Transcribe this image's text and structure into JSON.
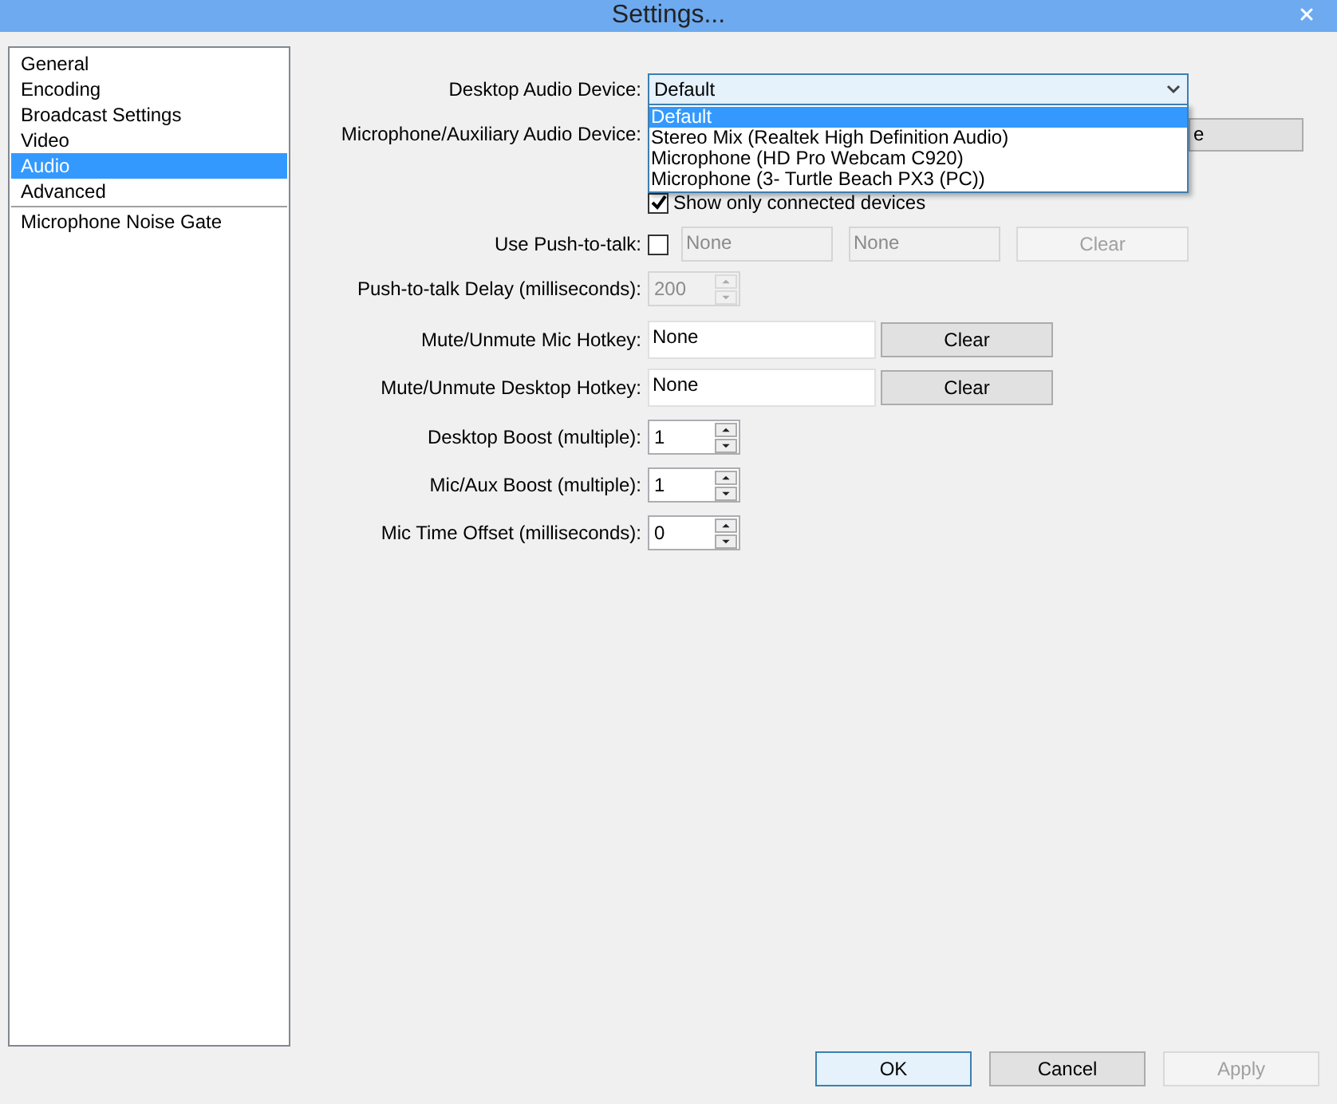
{
  "window": {
    "title": "Settings..."
  },
  "sidebar": {
    "items": [
      {
        "label": "General",
        "selected": false
      },
      {
        "label": "Encoding",
        "selected": false
      },
      {
        "label": "Broadcast Settings",
        "selected": false
      },
      {
        "label": "Video",
        "selected": false
      },
      {
        "label": "Audio",
        "selected": true
      },
      {
        "label": "Advanced",
        "selected": false
      }
    ],
    "plugin_items": [
      {
        "label": "Microphone Noise Gate",
        "selected": false
      }
    ]
  },
  "audio": {
    "desktop_device": {
      "label": "Desktop Audio Device:",
      "value": "Default",
      "expanded": true,
      "options": [
        {
          "label": "Default",
          "selected": true
        },
        {
          "label": "Stereo Mix (Realtek High Definition Audio)",
          "selected": false
        },
        {
          "label": "Microphone (HD Pro Webcam C920)",
          "selected": false
        },
        {
          "label": "Microphone (3- Turtle Beach PX3 (PC))",
          "selected": false
        }
      ]
    },
    "mic_device": {
      "label": "Microphone/Auxiliary Audio Device:",
      "button": "e"
    },
    "show_connected": {
      "label": "Show only connected devices",
      "checked": true
    },
    "push_to_talk": {
      "label": "Use Push-to-talk:",
      "checked": false,
      "hotkey": "None",
      "hotkey_alt": "None",
      "clear": {
        "label": "Clear",
        "disabled": true
      }
    },
    "ptt_delay": {
      "label": "Push-to-talk Delay (milliseconds):",
      "value": "200",
      "disabled": true
    },
    "hotkeys": [
      {
        "label": "Mute/Unmute Mic Hotkey:",
        "value": "None",
        "clear": "Clear"
      },
      {
        "label": "Mute/Unmute Desktop Hotkey:",
        "value": "None",
        "clear": "Clear"
      }
    ],
    "spinners": [
      {
        "label": "Desktop Boost (multiple):",
        "value": "1"
      },
      {
        "label": "Mic/Aux Boost (multiple):",
        "value": "1"
      },
      {
        "label": "Mic Time Offset (milliseconds):",
        "value": "0"
      }
    ]
  },
  "buttons": [
    {
      "label": "OK",
      "default": true,
      "disabled": false
    },
    {
      "label": "Cancel",
      "default": false,
      "disabled": false
    },
    {
      "label": "Apply",
      "default": false,
      "disabled": true
    }
  ]
}
